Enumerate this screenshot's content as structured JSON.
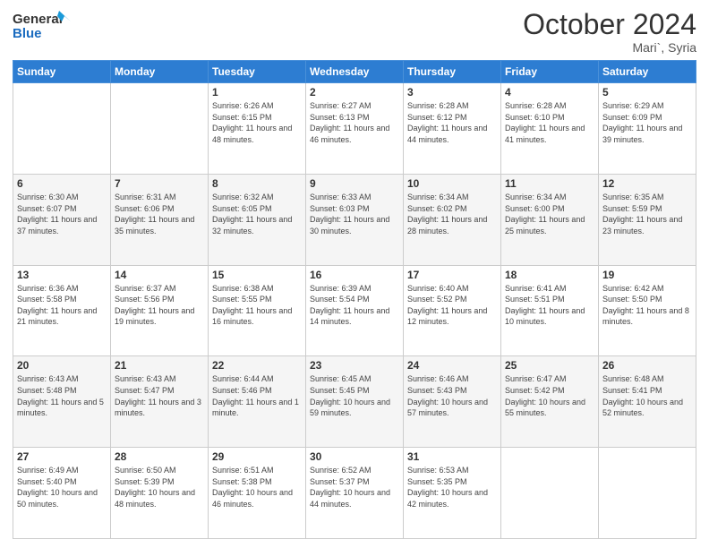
{
  "header": {
    "logo_line1": "General",
    "logo_line2": "Blue",
    "month": "October 2024",
    "location": "Mari`, Syria"
  },
  "weekdays": [
    "Sunday",
    "Monday",
    "Tuesday",
    "Wednesday",
    "Thursday",
    "Friday",
    "Saturday"
  ],
  "weeks": [
    [
      {
        "day": "",
        "sunrise": "",
        "sunset": "",
        "daylight": ""
      },
      {
        "day": "",
        "sunrise": "",
        "sunset": "",
        "daylight": ""
      },
      {
        "day": "1",
        "sunrise": "Sunrise: 6:26 AM",
        "sunset": "Sunset: 6:15 PM",
        "daylight": "Daylight: 11 hours and 48 minutes."
      },
      {
        "day": "2",
        "sunrise": "Sunrise: 6:27 AM",
        "sunset": "Sunset: 6:13 PM",
        "daylight": "Daylight: 11 hours and 46 minutes."
      },
      {
        "day": "3",
        "sunrise": "Sunrise: 6:28 AM",
        "sunset": "Sunset: 6:12 PM",
        "daylight": "Daylight: 11 hours and 44 minutes."
      },
      {
        "day": "4",
        "sunrise": "Sunrise: 6:28 AM",
        "sunset": "Sunset: 6:10 PM",
        "daylight": "Daylight: 11 hours and 41 minutes."
      },
      {
        "day": "5",
        "sunrise": "Sunrise: 6:29 AM",
        "sunset": "Sunset: 6:09 PM",
        "daylight": "Daylight: 11 hours and 39 minutes."
      }
    ],
    [
      {
        "day": "6",
        "sunrise": "Sunrise: 6:30 AM",
        "sunset": "Sunset: 6:07 PM",
        "daylight": "Daylight: 11 hours and 37 minutes."
      },
      {
        "day": "7",
        "sunrise": "Sunrise: 6:31 AM",
        "sunset": "Sunset: 6:06 PM",
        "daylight": "Daylight: 11 hours and 35 minutes."
      },
      {
        "day": "8",
        "sunrise": "Sunrise: 6:32 AM",
        "sunset": "Sunset: 6:05 PM",
        "daylight": "Daylight: 11 hours and 32 minutes."
      },
      {
        "day": "9",
        "sunrise": "Sunrise: 6:33 AM",
        "sunset": "Sunset: 6:03 PM",
        "daylight": "Daylight: 11 hours and 30 minutes."
      },
      {
        "day": "10",
        "sunrise": "Sunrise: 6:34 AM",
        "sunset": "Sunset: 6:02 PM",
        "daylight": "Daylight: 11 hours and 28 minutes."
      },
      {
        "day": "11",
        "sunrise": "Sunrise: 6:34 AM",
        "sunset": "Sunset: 6:00 PM",
        "daylight": "Daylight: 11 hours and 25 minutes."
      },
      {
        "day": "12",
        "sunrise": "Sunrise: 6:35 AM",
        "sunset": "Sunset: 5:59 PM",
        "daylight": "Daylight: 11 hours and 23 minutes."
      }
    ],
    [
      {
        "day": "13",
        "sunrise": "Sunrise: 6:36 AM",
        "sunset": "Sunset: 5:58 PM",
        "daylight": "Daylight: 11 hours and 21 minutes."
      },
      {
        "day": "14",
        "sunrise": "Sunrise: 6:37 AM",
        "sunset": "Sunset: 5:56 PM",
        "daylight": "Daylight: 11 hours and 19 minutes."
      },
      {
        "day": "15",
        "sunrise": "Sunrise: 6:38 AM",
        "sunset": "Sunset: 5:55 PM",
        "daylight": "Daylight: 11 hours and 16 minutes."
      },
      {
        "day": "16",
        "sunrise": "Sunrise: 6:39 AM",
        "sunset": "Sunset: 5:54 PM",
        "daylight": "Daylight: 11 hours and 14 minutes."
      },
      {
        "day": "17",
        "sunrise": "Sunrise: 6:40 AM",
        "sunset": "Sunset: 5:52 PM",
        "daylight": "Daylight: 11 hours and 12 minutes."
      },
      {
        "day": "18",
        "sunrise": "Sunrise: 6:41 AM",
        "sunset": "Sunset: 5:51 PM",
        "daylight": "Daylight: 11 hours and 10 minutes."
      },
      {
        "day": "19",
        "sunrise": "Sunrise: 6:42 AM",
        "sunset": "Sunset: 5:50 PM",
        "daylight": "Daylight: 11 hours and 8 minutes."
      }
    ],
    [
      {
        "day": "20",
        "sunrise": "Sunrise: 6:43 AM",
        "sunset": "Sunset: 5:48 PM",
        "daylight": "Daylight: 11 hours and 5 minutes."
      },
      {
        "day": "21",
        "sunrise": "Sunrise: 6:43 AM",
        "sunset": "Sunset: 5:47 PM",
        "daylight": "Daylight: 11 hours and 3 minutes."
      },
      {
        "day": "22",
        "sunrise": "Sunrise: 6:44 AM",
        "sunset": "Sunset: 5:46 PM",
        "daylight": "Daylight: 11 hours and 1 minute."
      },
      {
        "day": "23",
        "sunrise": "Sunrise: 6:45 AM",
        "sunset": "Sunset: 5:45 PM",
        "daylight": "Daylight: 10 hours and 59 minutes."
      },
      {
        "day": "24",
        "sunrise": "Sunrise: 6:46 AM",
        "sunset": "Sunset: 5:43 PM",
        "daylight": "Daylight: 10 hours and 57 minutes."
      },
      {
        "day": "25",
        "sunrise": "Sunrise: 6:47 AM",
        "sunset": "Sunset: 5:42 PM",
        "daylight": "Daylight: 10 hours and 55 minutes."
      },
      {
        "day": "26",
        "sunrise": "Sunrise: 6:48 AM",
        "sunset": "Sunset: 5:41 PM",
        "daylight": "Daylight: 10 hours and 52 minutes."
      }
    ],
    [
      {
        "day": "27",
        "sunrise": "Sunrise: 6:49 AM",
        "sunset": "Sunset: 5:40 PM",
        "daylight": "Daylight: 10 hours and 50 minutes."
      },
      {
        "day": "28",
        "sunrise": "Sunrise: 6:50 AM",
        "sunset": "Sunset: 5:39 PM",
        "daylight": "Daylight: 10 hours and 48 minutes."
      },
      {
        "day": "29",
        "sunrise": "Sunrise: 6:51 AM",
        "sunset": "Sunset: 5:38 PM",
        "daylight": "Daylight: 10 hours and 46 minutes."
      },
      {
        "day": "30",
        "sunrise": "Sunrise: 6:52 AM",
        "sunset": "Sunset: 5:37 PM",
        "daylight": "Daylight: 10 hours and 44 minutes."
      },
      {
        "day": "31",
        "sunrise": "Sunrise: 6:53 AM",
        "sunset": "Sunset: 5:35 PM",
        "daylight": "Daylight: 10 hours and 42 minutes."
      },
      {
        "day": "",
        "sunrise": "",
        "sunset": "",
        "daylight": ""
      },
      {
        "day": "",
        "sunrise": "",
        "sunset": "",
        "daylight": ""
      }
    ]
  ]
}
